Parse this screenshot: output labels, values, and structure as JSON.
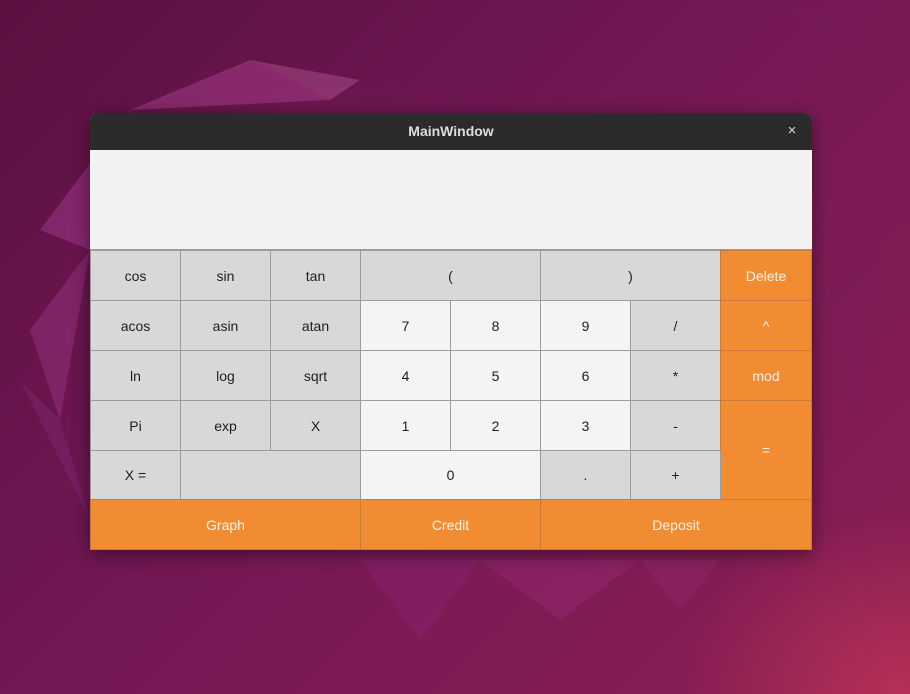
{
  "window": {
    "title": "MainWindow",
    "close_glyph": "×"
  },
  "display": {
    "value": ""
  },
  "buttons": {
    "cos": "cos",
    "sin": "sin",
    "tan": "tan",
    "lparen": "(",
    "rparen": ")",
    "delete": "Delete",
    "acos": "acos",
    "asin": "asin",
    "atan": "atan",
    "n7": "7",
    "n8": "8",
    "n9": "9",
    "div": "/",
    "pow": "^",
    "ln": "ln",
    "log": "log",
    "sqrt": "sqrt",
    "n4": "4",
    "n5": "5",
    "n6": "6",
    "mul": "*",
    "mod": "mod",
    "pi": "Pi",
    "exp": "exp",
    "x": "X",
    "n1": "1",
    "n2": "2",
    "n3": "3",
    "minus": "-",
    "equals": "=",
    "x_eq": "X =",
    "x_value": "",
    "n0": "0",
    "dot": ".",
    "plus": "+",
    "graph": "Graph",
    "credit": "Credit",
    "deposit": "Deposit"
  },
  "colors": {
    "accent": "#f28c33",
    "button": "#d8d8d8",
    "digit": "#f4f4f4",
    "titlebar": "#2b2b2b"
  }
}
